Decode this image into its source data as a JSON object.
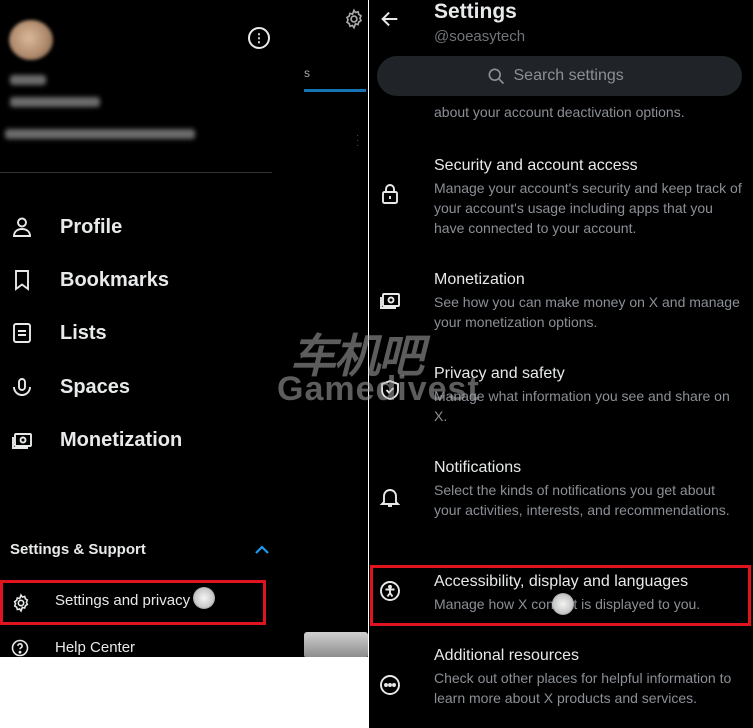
{
  "left_panel": {
    "nav_items": [
      {
        "label": "Profile",
        "icon": "person-icon"
      },
      {
        "label": "Bookmarks",
        "icon": "bookmark-icon"
      },
      {
        "label": "Lists",
        "icon": "list-icon"
      },
      {
        "label": "Spaces",
        "icon": "spaces-icon"
      },
      {
        "label": "Monetization",
        "icon": "money-icon"
      }
    ],
    "section_title": "Settings & Support",
    "settings_privacy_label": "Settings and privacy",
    "help_center_label": "Help Center"
  },
  "settings_page": {
    "title": "Settings",
    "handle": "@soeasytech",
    "search_placeholder": "Search settings",
    "truncated_desc": "about your account deactivation options.",
    "items": [
      {
        "title": "Security and account access",
        "desc": "Manage your account's security and keep track of your account's usage including apps that you have connected to your account.",
        "icon": "lock-icon"
      },
      {
        "title": "Monetization",
        "desc": "See how you can make money on X and manage your monetization options.",
        "icon": "money-icon"
      },
      {
        "title": "Privacy and safety",
        "desc": "Manage what information you see and share on X.",
        "icon": "shield-icon"
      },
      {
        "title": "Notifications",
        "desc": "Select the kinds of notifications you get about your activities, interests, and recommendations.",
        "icon": "bell-icon"
      },
      {
        "title": "Accessibility, display and languages",
        "desc": "Manage how X content is displayed to you.",
        "icon": "accessibility-icon"
      },
      {
        "title": "Additional resources",
        "desc": "Check out other places for helpful information to learn more about X products and services.",
        "icon": "more-circle-icon"
      }
    ]
  },
  "watermark": {
    "cn": "车机吧",
    "en": "Gamedivest"
  },
  "colors": {
    "background": "#000000",
    "highlight": "#e0141e",
    "accent": "#1d9bf0",
    "muted_text": "#8b9096"
  }
}
